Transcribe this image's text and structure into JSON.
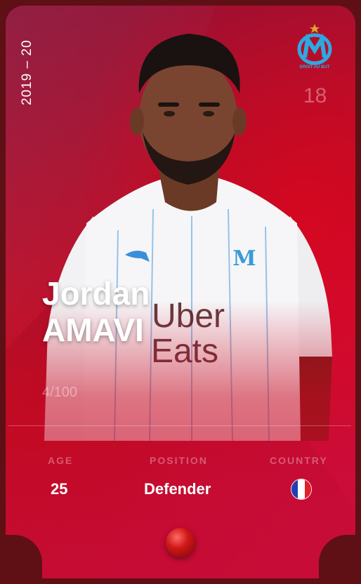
{
  "card": {
    "season": "2019 – 20",
    "number": "18",
    "first_name": "Jordan",
    "last_name": "AMAVI",
    "serial": "4/100"
  },
  "stats": {
    "age_label": "AGE",
    "age_value": "25",
    "position_label": "POSITION",
    "position_value": "Defender",
    "country_label": "COUNTRY",
    "country_flag": "france-flag"
  },
  "club": {
    "crest_text": "DROIT AU BUT",
    "crest_icon": "olympique-marseille-crest",
    "crest_color": "#2fa8e0"
  },
  "shirt": {
    "sponsor_line1": "Uber",
    "sponsor_line2": "Eats"
  },
  "colors": {
    "card_primary": "#c90a22",
    "card_accent": "#c81058",
    "flag_blue": "#1f3fb4",
    "flag_white": "#ffffff",
    "flag_red": "#e0202a"
  }
}
